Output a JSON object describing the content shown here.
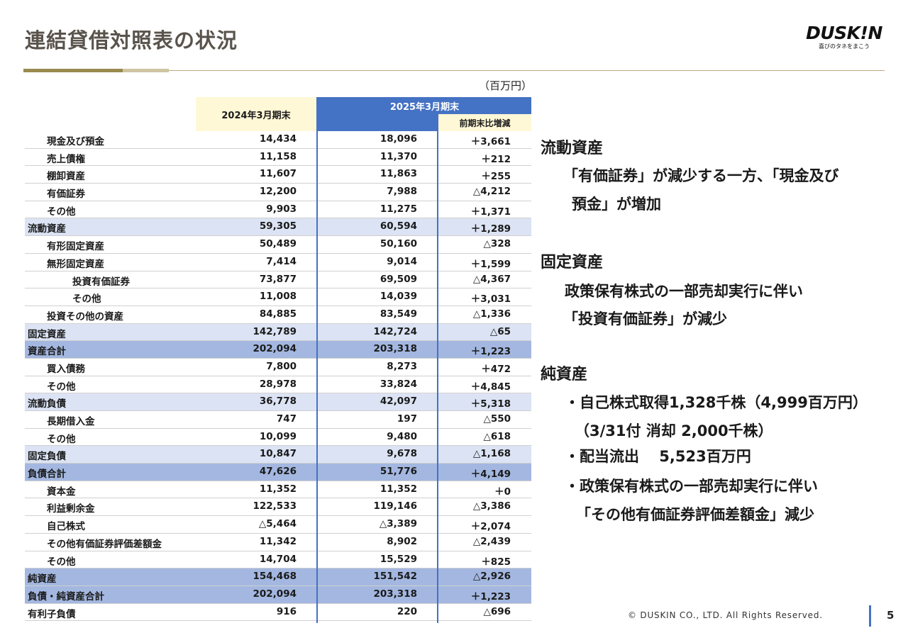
{
  "title": "連結貸借対照表の状況",
  "logo": {
    "word": "DUSK!N",
    "tagline": "喜びのタネをまこう"
  },
  "unit": "（百万円）",
  "header": {
    "col_2024": "2024年3月期末",
    "col_2025": "2025年3月期末",
    "col_diff": "前期末比増減"
  },
  "rows": [
    {
      "label": "現金及び預金",
      "v2024": "14,434",
      "v2025": "18,096",
      "diff": "＋3,661",
      "indent": 1,
      "style": "normal"
    },
    {
      "label": "売上債権",
      "v2024": "11,158",
      "v2025": "11,370",
      "diff": "＋212",
      "indent": 1,
      "style": "normal"
    },
    {
      "label": "棚卸資産",
      "v2024": "11,607",
      "v2025": "11,863",
      "diff": "＋255",
      "indent": 1,
      "style": "normal"
    },
    {
      "label": "有価証券",
      "v2024": "12,200",
      "v2025": "7,988",
      "diff": "△4,212",
      "indent": 1,
      "style": "normal"
    },
    {
      "label": "その他",
      "v2024": "9,903",
      "v2025": "11,275",
      "diff": "＋1,371",
      "indent": 1,
      "style": "normal"
    },
    {
      "label": "流動資産",
      "v2024": "59,305",
      "v2025": "60,594",
      "diff": "＋1,289",
      "indent": 0,
      "style": "sub"
    },
    {
      "label": "有形固定資産",
      "v2024": "50,489",
      "v2025": "50,160",
      "diff": "△328",
      "indent": 1,
      "style": "normal"
    },
    {
      "label": "無形固定資産",
      "v2024": "7,414",
      "v2025": "9,014",
      "diff": "＋1,599",
      "indent": 1,
      "style": "normal"
    },
    {
      "label": "投資有価証券",
      "v2024": "73,877",
      "v2025": "69,509",
      "diff": "△4,367",
      "indent": 2,
      "style": "normal"
    },
    {
      "label": "その他",
      "v2024": "11,008",
      "v2025": "14,039",
      "diff": "＋3,031",
      "indent": 2,
      "style": "normal"
    },
    {
      "label": "投資その他の資産",
      "v2024": "84,885",
      "v2025": "83,549",
      "diff": "△1,336",
      "indent": 1,
      "style": "normal"
    },
    {
      "label": "固定資産",
      "v2024": "142,789",
      "v2025": "142,724",
      "diff": "△65",
      "indent": 0,
      "style": "sub"
    },
    {
      "label": "資産合計",
      "v2024": "202,094",
      "v2025": "203,318",
      "diff": "＋1,223",
      "indent": 0,
      "style": "total"
    },
    {
      "label": "買入債務",
      "v2024": "7,800",
      "v2025": "8,273",
      "diff": "＋472",
      "indent": 1,
      "style": "normal"
    },
    {
      "label": "その他",
      "v2024": "28,978",
      "v2025": "33,824",
      "diff": "＋4,845",
      "indent": 1,
      "style": "normal"
    },
    {
      "label": "流動負債",
      "v2024": "36,778",
      "v2025": "42,097",
      "diff": "＋5,318",
      "indent": 0,
      "style": "sub"
    },
    {
      "label": "長期借入金",
      "v2024": "747",
      "v2025": "197",
      "diff": "△550",
      "indent": 1,
      "style": "normal"
    },
    {
      "label": "その他",
      "v2024": "10,099",
      "v2025": "9,480",
      "diff": "△618",
      "indent": 1,
      "style": "normal"
    },
    {
      "label": "固定負債",
      "v2024": "10,847",
      "v2025": "9,678",
      "diff": "△1,168",
      "indent": 0,
      "style": "sub"
    },
    {
      "label": "負債合計",
      "v2024": "47,626",
      "v2025": "51,776",
      "diff": "＋4,149",
      "indent": 0,
      "style": "total"
    },
    {
      "label": "資本金",
      "v2024": "11,352",
      "v2025": "11,352",
      "diff": "＋0",
      "indent": 1,
      "style": "normal"
    },
    {
      "label": "利益剰余金",
      "v2024": "122,533",
      "v2025": "119,146",
      "diff": "△3,386",
      "indent": 1,
      "style": "normal"
    },
    {
      "label": "自己株式",
      "v2024": "△5,464",
      "v2025": "△3,389",
      "diff": "＋2,074",
      "indent": 1,
      "style": "normal"
    },
    {
      "label": "その他有価証券評価差額金",
      "v2024": "11,342",
      "v2025": "8,902",
      "diff": "△2,439",
      "indent": 1,
      "style": "normal"
    },
    {
      "label": "その他",
      "v2024": "14,704",
      "v2025": "15,529",
      "diff": "＋825",
      "indent": 1,
      "style": "normal"
    },
    {
      "label": "純資産",
      "v2024": "154,468",
      "v2025": "151,542",
      "diff": "△2,926",
      "indent": 0,
      "style": "total"
    },
    {
      "label": "負債・純資産合計",
      "v2024": "202,094",
      "v2025": "203,318",
      "diff": "＋1,223",
      "indent": 0,
      "style": "total"
    },
    {
      "label": "有利子負債",
      "v2024": "916",
      "v2025": "220",
      "diff": "△696",
      "indent": 0,
      "style": "normal"
    }
  ],
  "notes": {
    "current_assets": {
      "heading": "流動資産",
      "lines": [
        "「有価証券」が減少する一方、「現金及び",
        "預金」が増加"
      ]
    },
    "fixed_assets": {
      "heading": "固定資産",
      "lines": [
        "政策保有株式の一部売却実行に伴い",
        "「投資有価証券」が減少"
      ]
    },
    "net_assets": {
      "heading": "純資産",
      "lines": [
        "・自己株式取得1,328千株（4,999百万円）",
        "（3/31付 消却 2,000千株）",
        "・配当流出　 5,523百万円",
        "・政策保有株式の一部売却実行に伴い",
        "「その他有価証券評価差額金」減少"
      ]
    }
  },
  "footer": {
    "copyright": "© DUSKIN CO., LTD. All Rights Reserved.",
    "page": "5"
  },
  "colors": {
    "title": "#59534c",
    "header_blue": "#4472c4",
    "header_yellow": "#fff8d6",
    "subtotal_row": "#dbe3f4",
    "total_row": "#a3b7e0",
    "rule_gold": "#9a8a4f"
  }
}
